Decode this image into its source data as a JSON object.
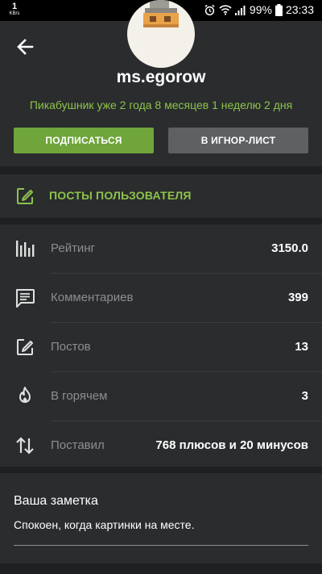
{
  "status_bar": {
    "net_speed": "1",
    "net_unit": "KB/s",
    "battery": "99%",
    "time": "23:33",
    "icons": [
      "alarm-icon",
      "wifi-icon",
      "signal-icon",
      "battery-icon"
    ]
  },
  "profile": {
    "username": "ms.egorow",
    "member_since": "Пикабушник уже 2 года 8 месяцев 1 неделю 2 дня",
    "subscribe_label": "ПОДПИСАТЬСЯ",
    "ignore_label": "В ИГНОР-ЛИСТ"
  },
  "posts_link": {
    "label": "ПОСТЫ ПОЛЬЗОВАТЕЛЯ",
    "icon": "edit-icon"
  },
  "stats": [
    {
      "label": "Рейтинг",
      "value": "3150.0",
      "icon": "bar-chart-icon"
    },
    {
      "label": "Комментариев",
      "value": "399",
      "icon": "comment-icon"
    },
    {
      "label": "Постов",
      "value": "13",
      "icon": "edit-icon"
    },
    {
      "label": "В горячем",
      "value": "3",
      "icon": "flame-icon"
    },
    {
      "label": "Поставил",
      "value": "768 плюсов и 20 минусов",
      "icon": "up-down-arrows-icon"
    }
  ],
  "note": {
    "title": "Ваша заметка",
    "text": "Спокоен, когда картинки на месте."
  },
  "colors": {
    "background": "#1e2022",
    "panel": "#2a2c2e",
    "accent_green": "#8dc34a",
    "button_green": "#6fa53b",
    "button_gray": "#5e6062",
    "muted_text": "#8c8e90"
  }
}
